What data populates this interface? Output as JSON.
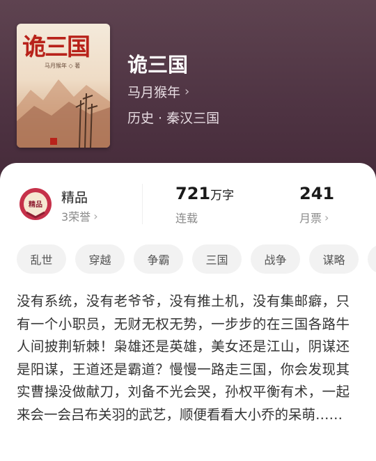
{
  "book": {
    "title": "诡三国",
    "author": "马月猴年",
    "genre": "历史 · 秦汉三国",
    "cover": {
      "title": "诡三国",
      "author_line": "马月猴年 ◇ 著"
    }
  },
  "stats": {
    "quality": {
      "label": "精品",
      "honors": "3荣誉",
      "badge_text": "精品"
    },
    "words": {
      "value": "721",
      "unit": "万字",
      "status": "连载"
    },
    "tickets": {
      "value": "241",
      "label": "月票"
    }
  },
  "tags": [
    "乱世",
    "穿越",
    "争霸",
    "三国",
    "战争",
    "谋略"
  ],
  "description": "没有系统，没有老爷爷，没有推土机，没有集邮癖，只有一个小职员，无财无权无势，一步步的在三国各路牛人间披荆斩棘！枭雄还是英雄，美女还是江山，阴谋还是阳谋，王道还是霸道？慢慢一路走三国，你会发现其实曹操没做献刀，刘备不光会哭，孙权平衡有术，一起来会一会吕布关羽的武艺，顺便看看大小乔的呆萌……",
  "colors": {
    "hero_bg": "#4f3443",
    "accent_red": "#b8221a",
    "tag_bg": "#f2f2f2"
  },
  "icons": {
    "chevron": "chevron-right-icon",
    "badge": "quality-badge-icon"
  }
}
